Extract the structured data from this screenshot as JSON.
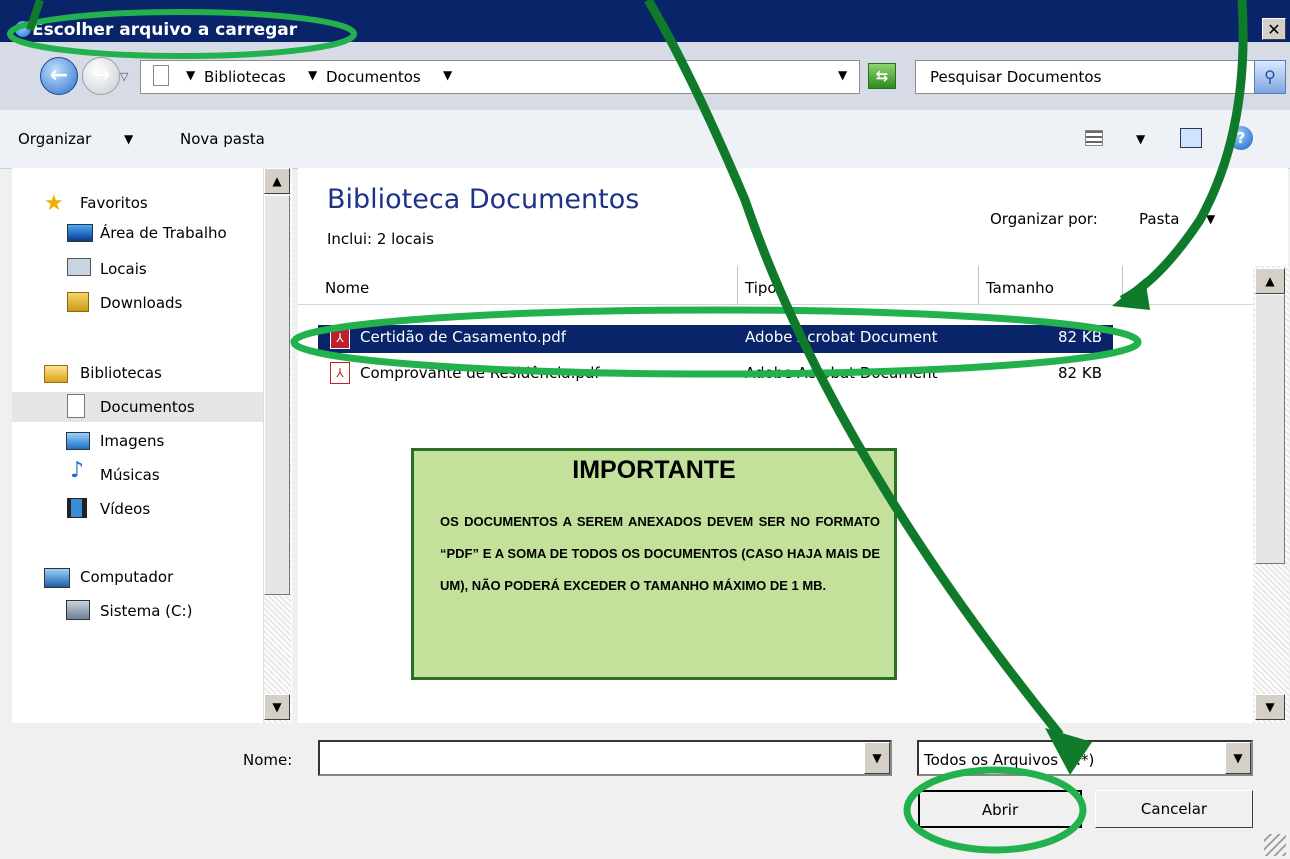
{
  "window": {
    "title": "Escolher arquivo a carregar",
    "close_glyph": "✕"
  },
  "address": {
    "breadcrumb": [
      "Bibliotecas",
      "Documentos"
    ],
    "search_placeholder": "Pesquisar Documentos"
  },
  "toolbar": {
    "organize": "Organizar",
    "new_folder": "Nova pasta"
  },
  "sidebar": {
    "groups": [
      {
        "label": "Favoritos",
        "items": [
          "Área de Trabalho",
          "Locais",
          "Downloads"
        ]
      },
      {
        "label": "Bibliotecas",
        "items": [
          "Documentos",
          "Imagens",
          "Músicas",
          "Vídeos"
        ]
      },
      {
        "label": "Computador",
        "items": [
          "Sistema (C:)"
        ]
      }
    ],
    "selected": "Documentos"
  },
  "library": {
    "title": "Biblioteca Documentos",
    "subtitle": "Inclui:  2 locais",
    "arrange_label": "Organizar por:",
    "arrange_value": "Pasta"
  },
  "columns": {
    "name": "Nome",
    "type": "Tipo",
    "size": "Tamanho"
  },
  "files": [
    {
      "name": "Certidão de Casamento.pdf",
      "type": "Adobe Acrobat Document",
      "size": "82 KB",
      "selected": true
    },
    {
      "name": "Comprovante de Residência.pdf",
      "type": "Adobe Acrobat Document",
      "size": "82 KB",
      "selected": false
    }
  ],
  "notice": {
    "title": "IMPORTANTE",
    "text": "OS DOCUMENTOS A SEREM ANEXADOS DEVEM SER NO FORMATO “PDF” E A SOMA DE TODOS OS DOCUMENTOS (CASO HAJA MAIS DE UM), NÃO PODERÁ EXCEDER O TAMANHO MÁXIMO DE 1 MB."
  },
  "footer": {
    "name_label": "Nome:",
    "name_value": "",
    "filter": "Todos os Arquivos (*.*)",
    "open": "Abrir",
    "cancel": "Cancelar"
  },
  "colors": {
    "title_bar": "#0a246a",
    "selection": "#0a246a",
    "library_title": "#1e3287",
    "annotation_green": "#22b14c",
    "arrow_green": "#0f7a2a",
    "notice_bg": "#c3e19a",
    "notice_border": "#2a6e2a"
  }
}
